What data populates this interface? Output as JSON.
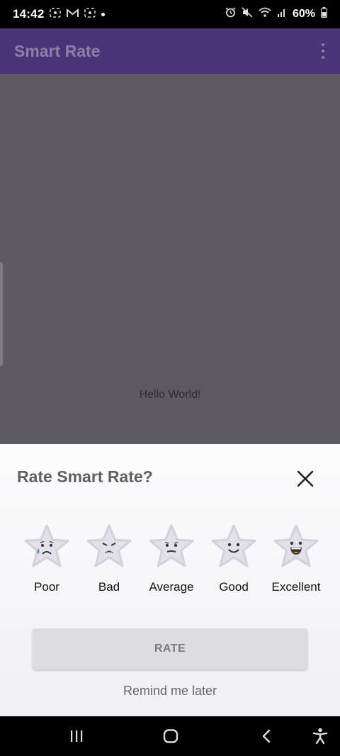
{
  "status_bar": {
    "time": "14:42",
    "left_icons": [
      "screenshot-icon",
      "gmail-icon",
      "screenshot-icon"
    ],
    "right_icons": [
      "alarm-icon",
      "mute-icon",
      "wifi-icon",
      "signal-icon"
    ],
    "battery": "60%"
  },
  "app_bar": {
    "title": "Smart Rate",
    "color": "#4b3478"
  },
  "content": {
    "hello_text": "Hello World!"
  },
  "dialog": {
    "title": "Rate Smart Rate?",
    "options": [
      {
        "label": "Poor",
        "face": "crying"
      },
      {
        "label": "Bad",
        "face": "distressed"
      },
      {
        "label": "Average",
        "face": "neutral"
      },
      {
        "label": "Good",
        "face": "smile"
      },
      {
        "label": "Excellent",
        "face": "grin"
      }
    ],
    "rate_label": "RATE",
    "remind_label": "Remind me later"
  },
  "nav_bar": {
    "icons": [
      "recents-icon",
      "home-icon",
      "back-icon",
      "accessibility-icon"
    ]
  }
}
